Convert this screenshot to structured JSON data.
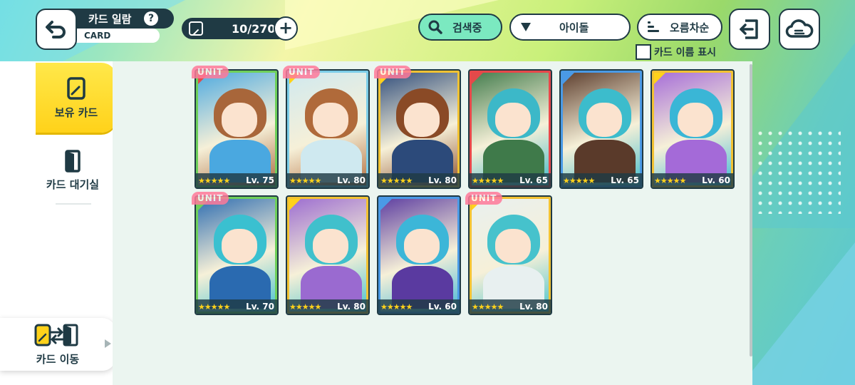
{
  "header": {
    "title": "카드 일람",
    "subtitle": "CARD",
    "help": "?",
    "card_count": "10/270",
    "plus": "+"
  },
  "toolbar": {
    "search_label": "검색중",
    "filter_label": "아이돌",
    "sort_label": "오름차순",
    "name_toggle_label": "카드 이름 표시"
  },
  "sidebar": {
    "owned_label": "보유 카드",
    "waiting_label": "카드 대기실",
    "move_label": "카드 이동"
  },
  "cards": [
    {
      "unit": "UNIT",
      "level": "Lv. 75",
      "stars": "★★★★★",
      "hair": "#a8663a",
      "outfit": "#4aa8e0",
      "frame": "#6fd05a",
      "attr": "#e24a4a"
    },
    {
      "unit": "UNIT",
      "level": "Lv. 80",
      "stars": "★★★★★",
      "hair": "#b06a3a",
      "outfit": "#cfe9f0",
      "frame": "#7ccde8",
      "attr": "#ffd21a"
    },
    {
      "unit": "UNIT",
      "level": "Lv. 80",
      "stars": "★★★★★",
      "hair": "#8a4a26",
      "outfit": "#2c4a7a",
      "frame": "#f2c232",
      "attr": "#ffd21a"
    },
    {
      "unit": "",
      "level": "Lv. 65",
      "stars": "★★★★★",
      "hair": "#3cb8c8",
      "outfit": "#3f7a4a",
      "frame": "#e8474a",
      "attr": "#e24a4a"
    },
    {
      "unit": "",
      "level": "Lv. 65",
      "stars": "★★★★★",
      "hair": "#3cbccc",
      "outfit": "#5a3a2a",
      "frame": "#4a9ae6",
      "attr": "#4a9ae6"
    },
    {
      "unit": "",
      "level": "Lv. 60",
      "stars": "★★★★★",
      "hair": "#3ab6d6",
      "outfit": "#a46ad8",
      "frame": "#f2c232",
      "attr": "#ffd21a"
    },
    {
      "unit": "UNIT",
      "level": "Lv. 70",
      "stars": "★★★★★",
      "hair": "#3ac0d0",
      "outfit": "#2a6ab0",
      "frame": "#6fd05a",
      "attr": "#6fd05a"
    },
    {
      "unit": "",
      "level": "Lv. 80",
      "stars": "★★★★★",
      "hair": "#40c0cc",
      "outfit": "#9a6ad0",
      "frame": "#f2c232",
      "attr": "#ffd21a"
    },
    {
      "unit": "",
      "level": "Lv. 60",
      "stars": "★★★★★",
      "hair": "#3cb6d8",
      "outfit": "#5a3aa0",
      "frame": "#4a9ae6",
      "attr": "#4a9ae6"
    },
    {
      "unit": "UNIT",
      "level": "Lv. 80",
      "stars": "★★★★★",
      "hair": "#46c2cc",
      "outfit": "#e8f0f0",
      "frame": "#f2c232",
      "attr": "#ffd21a"
    }
  ],
  "colors": {
    "dark": "#1f3a44",
    "accent_yellow": "#ffd21a",
    "search_active": "#7be9c0",
    "unit_tag": "#ff7a9a"
  }
}
